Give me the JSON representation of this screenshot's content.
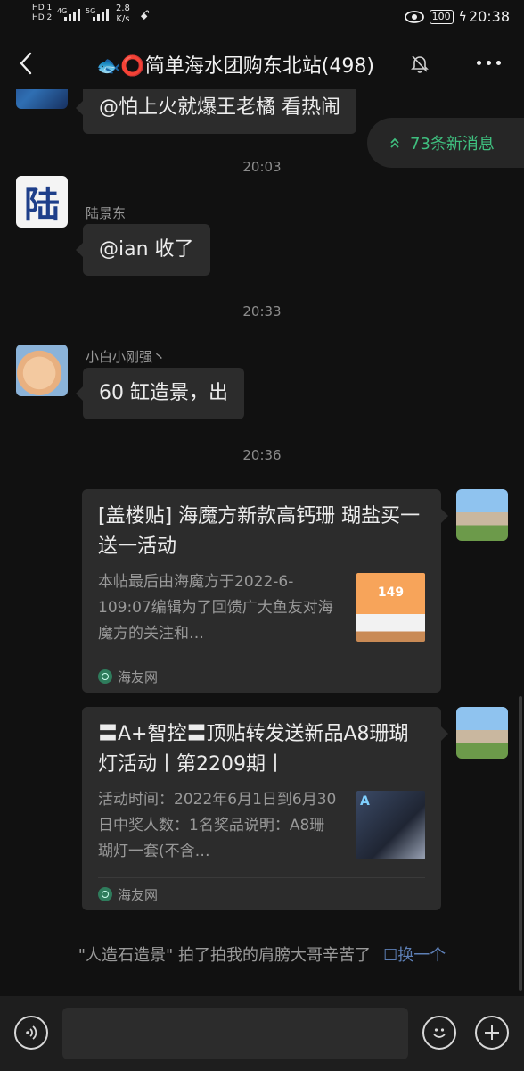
{
  "status_bar": {
    "hd1": "HD 1",
    "hd2": "HD 2",
    "net1": "4G",
    "net2": "5G",
    "speed_value": "2.8",
    "speed_unit": "K/s",
    "battery": "100",
    "time": "20:38"
  },
  "header": {
    "title": "🐟⭕简单海水团购东北站(498)"
  },
  "new_messages": {
    "label": "73条新消息"
  },
  "messages": [
    {
      "type": "text",
      "text": "@怕上火就爆王老橘  看热闹"
    },
    {
      "type": "time",
      "text": "20:03"
    },
    {
      "type": "text",
      "sender": "陆景东",
      "avatar_char": "陆",
      "text": "@ian  收了"
    },
    {
      "type": "time",
      "text": "20:33"
    },
    {
      "type": "text",
      "sender": "小白小刚强丶",
      "text": "60 缸造景，出"
    },
    {
      "type": "time",
      "text": "20:36"
    }
  ],
  "cards": [
    {
      "title": "[盖楼贴] 海魔方新款高钙珊 瑚盐买一送一活动",
      "desc": "本帖最后由海魔方于2022-6-109:07编辑为了回馈广大鱼友对海魔方的关注和…",
      "source": "海友网",
      "thumb_text": "149"
    },
    {
      "title": "〓A+智控〓顶贴转发送新品A8珊瑚灯活动丨第2209期丨",
      "desc": "活动时间：2022年6月1日到6月30日中奖人数：1名奖品说明：A8珊瑚灯一套(不含…",
      "source": "海友网",
      "thumb_text": "A"
    }
  ],
  "pat": {
    "text": "\"人造石造景\" 拍了拍我的肩膀大哥辛苦了",
    "switch_label": "换一个"
  },
  "colors": {
    "background": "#111111",
    "bubble": "#2c2c2c",
    "accent_green": "#3fbf7f",
    "link_blue": "#5d7fb5"
  }
}
